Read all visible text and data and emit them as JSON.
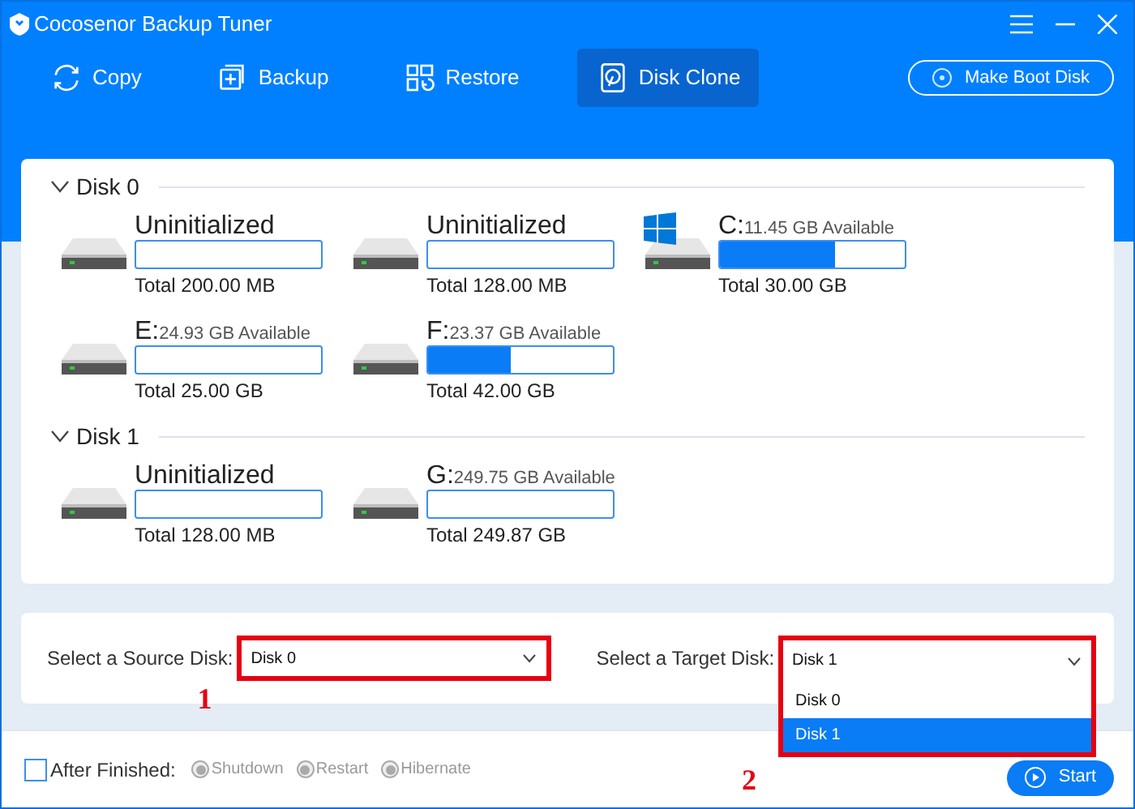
{
  "window": {
    "title": "Cocosenor Backup Tuner"
  },
  "nav": [
    {
      "label": "Copy",
      "selected": false
    },
    {
      "label": "Backup",
      "selected": false
    },
    {
      "label": "Restore",
      "selected": false
    },
    {
      "label": "Disk Clone",
      "selected": true
    }
  ],
  "boot_button": "Make Boot Disk",
  "disks": [
    {
      "name": "Disk 0",
      "expanded": true,
      "partitions": [
        {
          "label": "Uninitialized",
          "level": 0,
          "total": "Total 200.00 MB",
          "system": false
        },
        {
          "label": "Uninitialized",
          "level": 0,
          "total": "Total 128.00 MB",
          "system": false
        },
        {
          "label": "C:",
          "available": "11.45 GB Available",
          "level": 0.62,
          "total": "Total 30.00 GB",
          "system": true
        },
        {
          "label": "E:",
          "available": "24.93 GB Available",
          "level": 0,
          "total": "Total 25.00 GB",
          "system": false
        },
        {
          "label": "F:",
          "available": "23.37 GB Available",
          "level": 0.45,
          "total": "Total 42.00 GB",
          "system": false
        }
      ]
    },
    {
      "name": "Disk 1",
      "expanded": true,
      "partitions": [
        {
          "label": "Uninitialized",
          "level": 0,
          "total": "Total 128.00 MB",
          "system": false
        },
        {
          "label": "G:",
          "available": "249.75 GB Available",
          "level": 0,
          "total": "Total 249.87 GB",
          "system": false
        }
      ]
    }
  ],
  "source": {
    "label": "Select a Source Disk:",
    "value": "Disk 0",
    "marker": "1"
  },
  "target": {
    "label": "Select a Target Disk:",
    "value": "Disk 1",
    "marker": "2",
    "options": [
      {
        "label": "Disk 0",
        "selected": false
      },
      {
        "label": "Disk 1",
        "selected": true
      }
    ]
  },
  "after_finished": {
    "label": "After Finished:",
    "checked": false,
    "options": [
      {
        "label": "Shutdown",
        "disabled": true
      },
      {
        "label": "Restart",
        "disabled": true
      },
      {
        "label": "Hibernate",
        "disabled": true
      }
    ]
  },
  "start_button": "Start"
}
